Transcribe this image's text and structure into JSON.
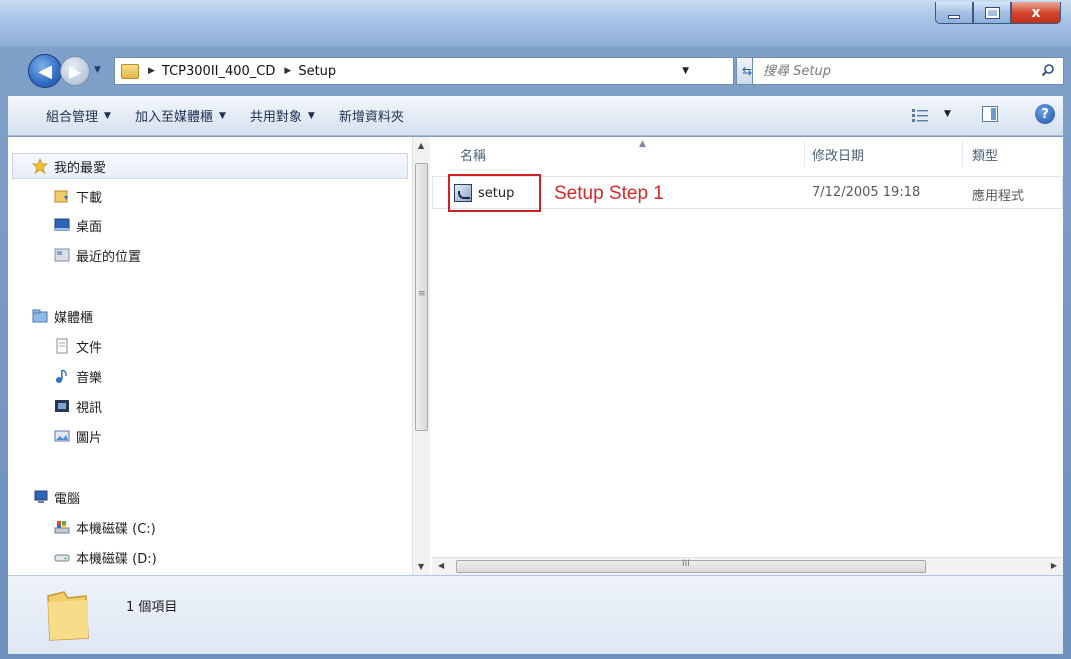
{
  "window": {
    "caption_buttons": {
      "minimize": "minimize",
      "maximize": "maximize",
      "close": "x"
    }
  },
  "address_bar": {
    "breadcrumbs": [
      "TCP300II_400_CD",
      "Setup"
    ],
    "search_placeholder": "搜尋 Setup",
    "back_glyph": "◀",
    "forward_glyph": "▶"
  },
  "toolbar": {
    "organize_label": "組合管理",
    "add_to_library_label": "加入至媒體櫃",
    "share_label": "共用對象",
    "new_folder_label": "新增資料夾",
    "help_glyph": "?"
  },
  "nav_pane": {
    "favorites": {
      "label": "我的最愛",
      "items": [
        "下載",
        "桌面",
        "最近的位置"
      ]
    },
    "libraries": {
      "label": "媒體櫃",
      "items": [
        "文件",
        "音樂",
        "視訊",
        "圖片"
      ]
    },
    "computer": {
      "label": "電腦",
      "items": [
        "本機磁碟 (C:)",
        "本機磁碟 (D:)"
      ]
    }
  },
  "file_list": {
    "columns": [
      "名稱",
      "修改日期",
      "類型"
    ],
    "files": [
      {
        "name": "setup",
        "modified": "7/12/2005 19:18",
        "type": "應用程式"
      }
    ],
    "annotation": "Setup Step 1"
  },
  "status": {
    "item_count": "1 個項目"
  },
  "colors": {
    "annotation": "#d42a2a",
    "highlight_border": "#d02020",
    "accent": "#2f6cc4"
  }
}
